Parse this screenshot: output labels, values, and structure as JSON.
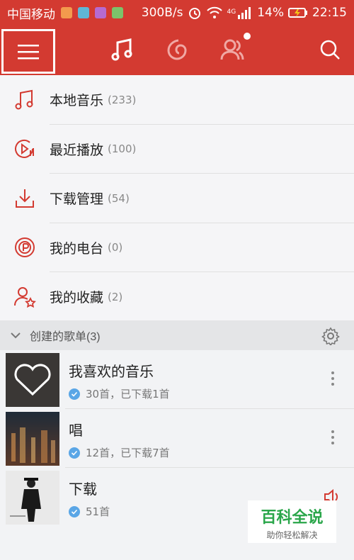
{
  "status_bar": {
    "carrier": "中国移动",
    "speed": "300B/s",
    "network_type": "4G",
    "battery": "14%",
    "time": "22:15",
    "colors": {
      "bg": "#d33a31"
    }
  },
  "top_nav": {
    "icons": [
      "menu-icon",
      "music-note-icon",
      "netease-cloud-icon",
      "friends-icon",
      "search-icon"
    ]
  },
  "main": {
    "items": [
      {
        "label": "本地音乐",
        "count": "(233)",
        "icon": "music-note-icon"
      },
      {
        "label": "最近播放",
        "count": "(100)",
        "icon": "recent-play-icon"
      },
      {
        "label": "下载管理",
        "count": "(54)",
        "icon": "download-icon"
      },
      {
        "label": "我的电台",
        "count": "(0)",
        "icon": "radio-icon"
      },
      {
        "label": "我的收藏",
        "count": "(2)",
        "icon": "favorite-user-icon"
      }
    ]
  },
  "section": {
    "title": "创建的歌单(3)"
  },
  "playlists": [
    {
      "name": "我喜欢的音乐",
      "meta": "30首，已下载1首"
    },
    {
      "name": "唱",
      "meta": "12首，已下载7首"
    },
    {
      "name": "下载",
      "meta": "51首"
    }
  ],
  "watermark": {
    "title": "百科全说",
    "subtitle": "助你轻松解决"
  }
}
